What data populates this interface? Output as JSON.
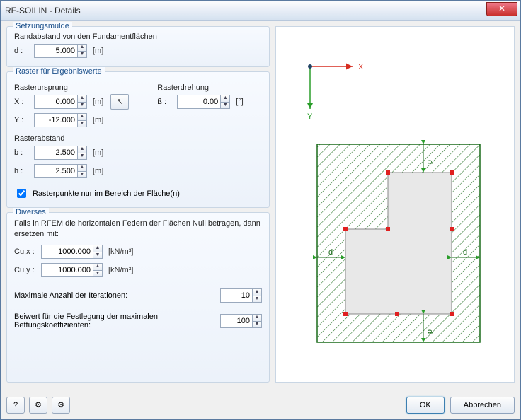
{
  "window": {
    "title": "RF-SOILIN - Details"
  },
  "setzungsmulde": {
    "title": "Setzungsmulde",
    "rand_label": "Randabstand von den Fundamentflächen",
    "d_label": "d :",
    "d_value": "5.000",
    "d_unit": "[m]"
  },
  "raster": {
    "title": "Raster für Ergebniswerte",
    "ursprung_label": "Rasterursprung",
    "x_label": "X :",
    "x_value": "0.000",
    "x_unit": "[m]",
    "y_label": "Y :",
    "y_value": "-12.000",
    "y_unit": "[m]",
    "drehung_label": "Rasterdrehung",
    "beta_label": "ß :",
    "beta_value": "0.00",
    "beta_unit": "[°]",
    "abstand_label": "Rasterabstand",
    "b_label": "b :",
    "b_value": "2.500",
    "b_unit": "[m]",
    "h_label": "h :",
    "h_value": "2.500",
    "h_unit": "[m]",
    "chk_label": "Rasterpunkte nur im Bereich der Fläche(n)",
    "chk_checked": true
  },
  "diverses": {
    "title": "Diverses",
    "intro": "Falls in RFEM die horizontalen Federn der Flächen Null betragen, dann ersetzen mit:",
    "cux_label": "Cu,x :",
    "cux_value": "1000.000",
    "cuy_label": "Cu,y :",
    "cuy_value": "1000.000",
    "c_unit": "[kN/m³]",
    "iter_label": "Maximale Anzahl der Iterationen:",
    "iter_value": "10",
    "beiwert_label": "Beiwert für die Festlegung der maximalen Bettungskoeffizienten:",
    "beiwert_value": "100"
  },
  "axes": {
    "x": "X",
    "y": "Y",
    "d": "d"
  },
  "buttons": {
    "ok": "OK",
    "cancel": "Abbrechen"
  },
  "close": "✕"
}
